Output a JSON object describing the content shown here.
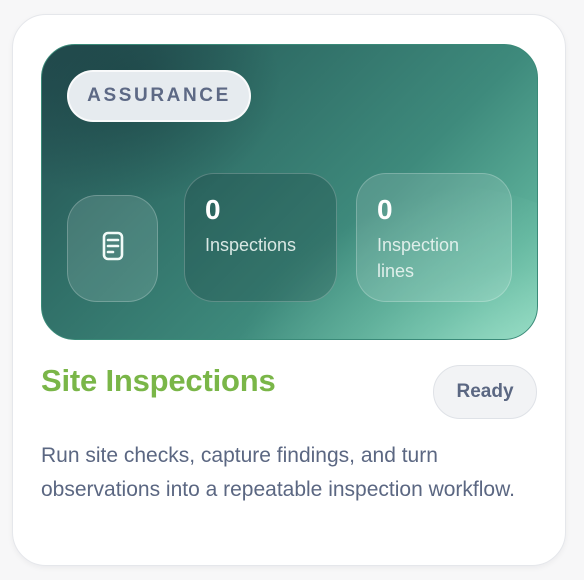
{
  "card": {
    "tag": "ASSURANCE",
    "icon": "document-stack-icon",
    "stats": [
      {
        "value": "0",
        "label": "Inspections"
      },
      {
        "value": "0",
        "label": "Inspection lines"
      }
    ],
    "title": "Site Inspections",
    "status": "Ready",
    "description": "Run site checks, capture findings, and turn observations into a repeatable inspection workflow."
  },
  "colors": {
    "title": "#7ab648",
    "hero_dark": "#234c4f",
    "hero_light": "#86d2b8",
    "muted_text": "#5b6782"
  }
}
